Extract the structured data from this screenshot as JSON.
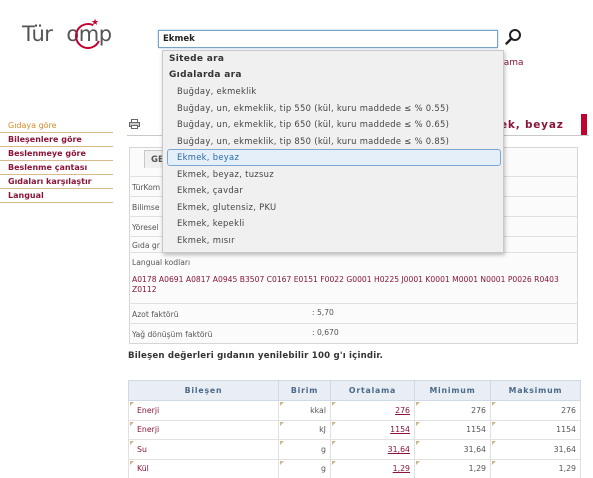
{
  "logo": {
    "text_part1": "Tür",
    "text_part2": "omp"
  },
  "search": {
    "value": "Ekmek",
    "link_suffix": "rama"
  },
  "dropdown": {
    "section1": "Sitede ara",
    "section2": "Gıdalarda ara",
    "items": [
      "Buğday, ekmeklik",
      "Buğday, un, ekmeklik, tip 550 (kül, kuru maddede ≤ % 0.55)",
      "Buğday, un, ekmeklik, tip 650 (kül, kuru maddede ≤ % 0.65)",
      "Buğday, un, ekmeklik, tip 850 (kül, kuru maddede ≤ % 0.85)",
      "Ekmek, beyaz",
      "Ekmek, beyaz, tuzsuz",
      "Ekmek, çavdar",
      "Ekmek, glutensiz, PKU",
      "Ekmek, kepekli",
      "Ekmek, mısır"
    ],
    "selected_index": 4
  },
  "left_menu": [
    "Gıdaya göre",
    "Bileşenlere göre",
    "Beslenmeye göre",
    "Beslenme çantası",
    "Gıdaları karşılaştır",
    "Langual"
  ],
  "title_fragment": "ek, beyaz",
  "general": {
    "tab": "GE",
    "rows": [
      "TürKom",
      "Bilimse",
      "Yöresel",
      "Gıda gr"
    ],
    "langual_label": "Langual kodları",
    "langual_codes": "A0178 A0691 A0817 A0945 B3507 C0167 E0151 F0022 G0001 H0225 J0001 K0001 M0001 N0001 P0026 R0403 Z0112",
    "nitrogen_label": "Azot faktörü",
    "nitrogen_value": ": 5,70",
    "fat_label": "Yağ dönüşüm faktörü",
    "fat_value": ": 0,670"
  },
  "note": "Bileşen değerleri gıdanın yenilebilir 100 g'ı içindir.",
  "table": {
    "headers": [
      "Bileşen",
      "Birim",
      "Ortalama",
      "Minimum",
      "Maksimum"
    ],
    "rows": [
      {
        "name": "Enerji",
        "unit": "kkal",
        "avg": "276",
        "min": "276",
        "max": "276"
      },
      {
        "name": "Enerji",
        "unit": "kJ",
        "avg": "1154",
        "min": "1154",
        "max": "1154"
      },
      {
        "name": "Su",
        "unit": "g",
        "avg": "31,64",
        "min": "31,64",
        "max": "31,64"
      },
      {
        "name": "Kül",
        "unit": "g",
        "avg": "1,29",
        "min": "1,29",
        "max": "1,29"
      }
    ]
  },
  "colors": {
    "brand": "#c2002f",
    "link": "#8a1538",
    "selection": "#7ba8d2"
  }
}
